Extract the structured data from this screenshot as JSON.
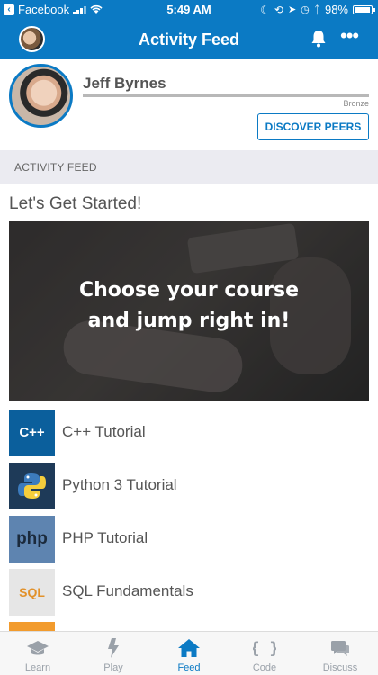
{
  "status_bar": {
    "back_label": "Facebook",
    "time": "5:49 AM",
    "battery": "98%",
    "battery_level": 0.98
  },
  "nav": {
    "title": "Activity Feed",
    "more_label": "•••"
  },
  "profile": {
    "name": "Jeff Byrnes",
    "rank": "Bronze",
    "discover_button": "DISCOVER PEERS"
  },
  "feed": {
    "section_title": "ACTIVITY FEED",
    "get_started": "Let's Get Started!",
    "hero_line1": "Choose your course",
    "hero_line2": "and jump right in!"
  },
  "courses": [
    {
      "label": "C++ Tutorial",
      "thumb_text": "C++",
      "icon": "cpp-icon"
    },
    {
      "label": "Python 3 Tutorial",
      "thumb_text": "",
      "icon": "python-icon"
    },
    {
      "label": "PHP Tutorial",
      "thumb_text": "php",
      "icon": "php-icon"
    },
    {
      "label": "SQL Fundamentals",
      "thumb_text": "SQL",
      "icon": "sql-icon"
    }
  ],
  "tabs": [
    {
      "label": "Learn",
      "icon": "graduation-cap-icon",
      "active": false
    },
    {
      "label": "Play",
      "icon": "lightning-icon",
      "active": false
    },
    {
      "label": "Feed",
      "icon": "home-icon",
      "active": true
    },
    {
      "label": "Code",
      "icon": "braces-icon",
      "active": false
    },
    {
      "label": "Discuss",
      "icon": "chat-bubble-icon",
      "active": false
    }
  ],
  "colors": {
    "brand": "#0b7ac4",
    "tab_inactive": "#9aa1a9"
  }
}
